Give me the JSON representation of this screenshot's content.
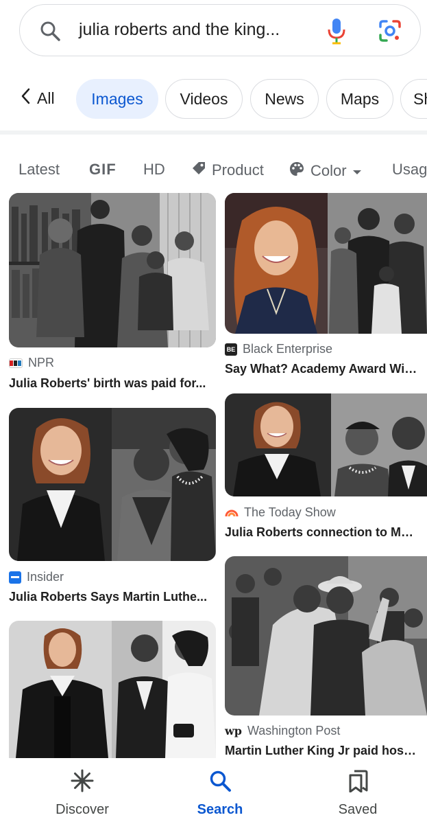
{
  "search": {
    "query": "julia roberts and the king...",
    "icons": [
      "search-icon",
      "mic-icon",
      "lens-icon"
    ]
  },
  "tabs": {
    "back_label": "All",
    "items": [
      "Images",
      "Videos",
      "News",
      "Maps",
      "Sh"
    ],
    "active": "Images"
  },
  "filters": {
    "items": [
      "Latest",
      "GIF",
      "HD",
      "Product",
      "Color",
      "Usag"
    ],
    "icons": [
      "tag-icon",
      "palette-icon",
      "dropdown-arrow-icon"
    ]
  },
  "results": [
    {
      "source": "NPR",
      "caption": "Julia Roberts' birth was paid for..."
    },
    {
      "source": "Black Enterprise",
      "caption": "Say What? Academy Award Win..."
    },
    {
      "source": "Insider",
      "caption": "Julia Roberts Says Martin Luthe..."
    },
    {
      "source": "The Today Show",
      "caption": "Julia Roberts connection to Mar..."
    },
    {
      "source": "Washington Post",
      "caption": "Martin Luther King Jr paid hospi..."
    }
  ],
  "bottom_nav": {
    "items": [
      "Discover",
      "Search",
      "Saved"
    ],
    "active": "Search"
  },
  "colors": {
    "accent": "#0b57d0",
    "active_chip_bg": "#e8f0fe",
    "border": "#dadce0",
    "secondary_text": "#5f6368"
  }
}
